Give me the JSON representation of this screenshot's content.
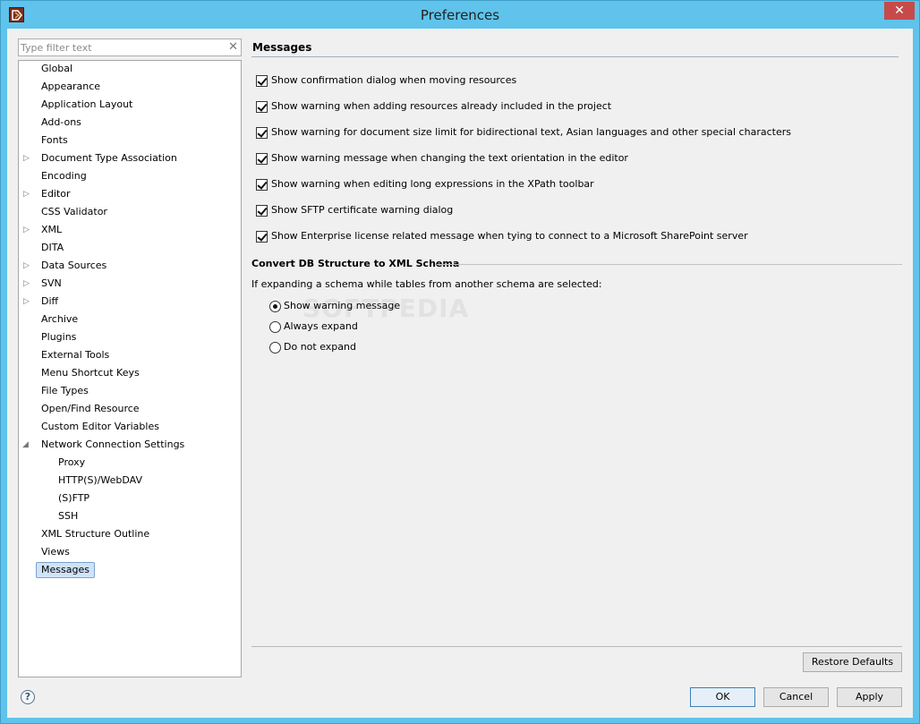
{
  "window": {
    "title": "Preferences",
    "close_glyph": "✕"
  },
  "filter": {
    "placeholder": "Type filter text",
    "clear_glyph": "✕"
  },
  "tree": {
    "items": [
      {
        "label": "Global"
      },
      {
        "label": "Appearance"
      },
      {
        "label": "Application Layout"
      },
      {
        "label": "Add-ons"
      },
      {
        "label": "Fonts"
      },
      {
        "label": "Document Type Association"
      },
      {
        "label": "Encoding"
      },
      {
        "label": "Editor"
      },
      {
        "label": "CSS Validator"
      },
      {
        "label": "XML"
      },
      {
        "label": "DITA"
      },
      {
        "label": "Data Sources"
      },
      {
        "label": "SVN"
      },
      {
        "label": "Diff"
      },
      {
        "label": "Archive"
      },
      {
        "label": "Plugins"
      },
      {
        "label": "External Tools"
      },
      {
        "label": "Menu Shortcut Keys"
      },
      {
        "label": "File Types"
      },
      {
        "label": "Open/Find Resource"
      },
      {
        "label": "Custom Editor Variables"
      },
      {
        "label": "Network Connection Settings"
      },
      {
        "label": "Proxy"
      },
      {
        "label": "HTTP(S)/WebDAV"
      },
      {
        "label": "(S)FTP"
      },
      {
        "label": "SSH"
      },
      {
        "label": "XML Structure Outline"
      },
      {
        "label": "Views"
      },
      {
        "label": "Messages"
      }
    ],
    "selected": "Messages",
    "collapsed_glyph": "▷",
    "expanded_glyph": "◢"
  },
  "messages": {
    "title": "Messages",
    "options": [
      {
        "label": "Show confirmation dialog when moving resources",
        "checked": true
      },
      {
        "label": "Show warning when adding resources already included in the project",
        "checked": true
      },
      {
        "label": "Show warning for document size limit for bidirectional text, Asian languages and other special characters",
        "checked": true
      },
      {
        "label": "Show warning message when changing the text orientation in the editor",
        "checked": true
      },
      {
        "label": "Show warning when editing long expressions in the XPath toolbar",
        "checked": true
      },
      {
        "label": "Show SFTP certificate warning dialog",
        "checked": true
      },
      {
        "label": "Show Enterprise license related message when tying to connect to a Microsoft SharePoint server",
        "checked": true
      }
    ]
  },
  "db_structure": {
    "title": "Convert DB Structure to XML Schema",
    "description": "If expanding a schema while tables from another schema are selected:",
    "radios": [
      {
        "label": "Show warning message",
        "selected": true
      },
      {
        "label": "Always expand",
        "selected": false
      },
      {
        "label": "Do not expand",
        "selected": false
      }
    ]
  },
  "watermark": "SOFTPEDIA",
  "buttons": {
    "restore_defaults": "Restore Defaults",
    "ok": "OK",
    "cancel": "Cancel",
    "apply": "Apply",
    "help": "?"
  },
  "icons": {
    "app": "oxygen-app-icon",
    "help": "help-icon"
  },
  "colors": {
    "titlebar": "#5fc3ec",
    "close": "#c74a4a",
    "selection": "#cfe3f8"
  }
}
